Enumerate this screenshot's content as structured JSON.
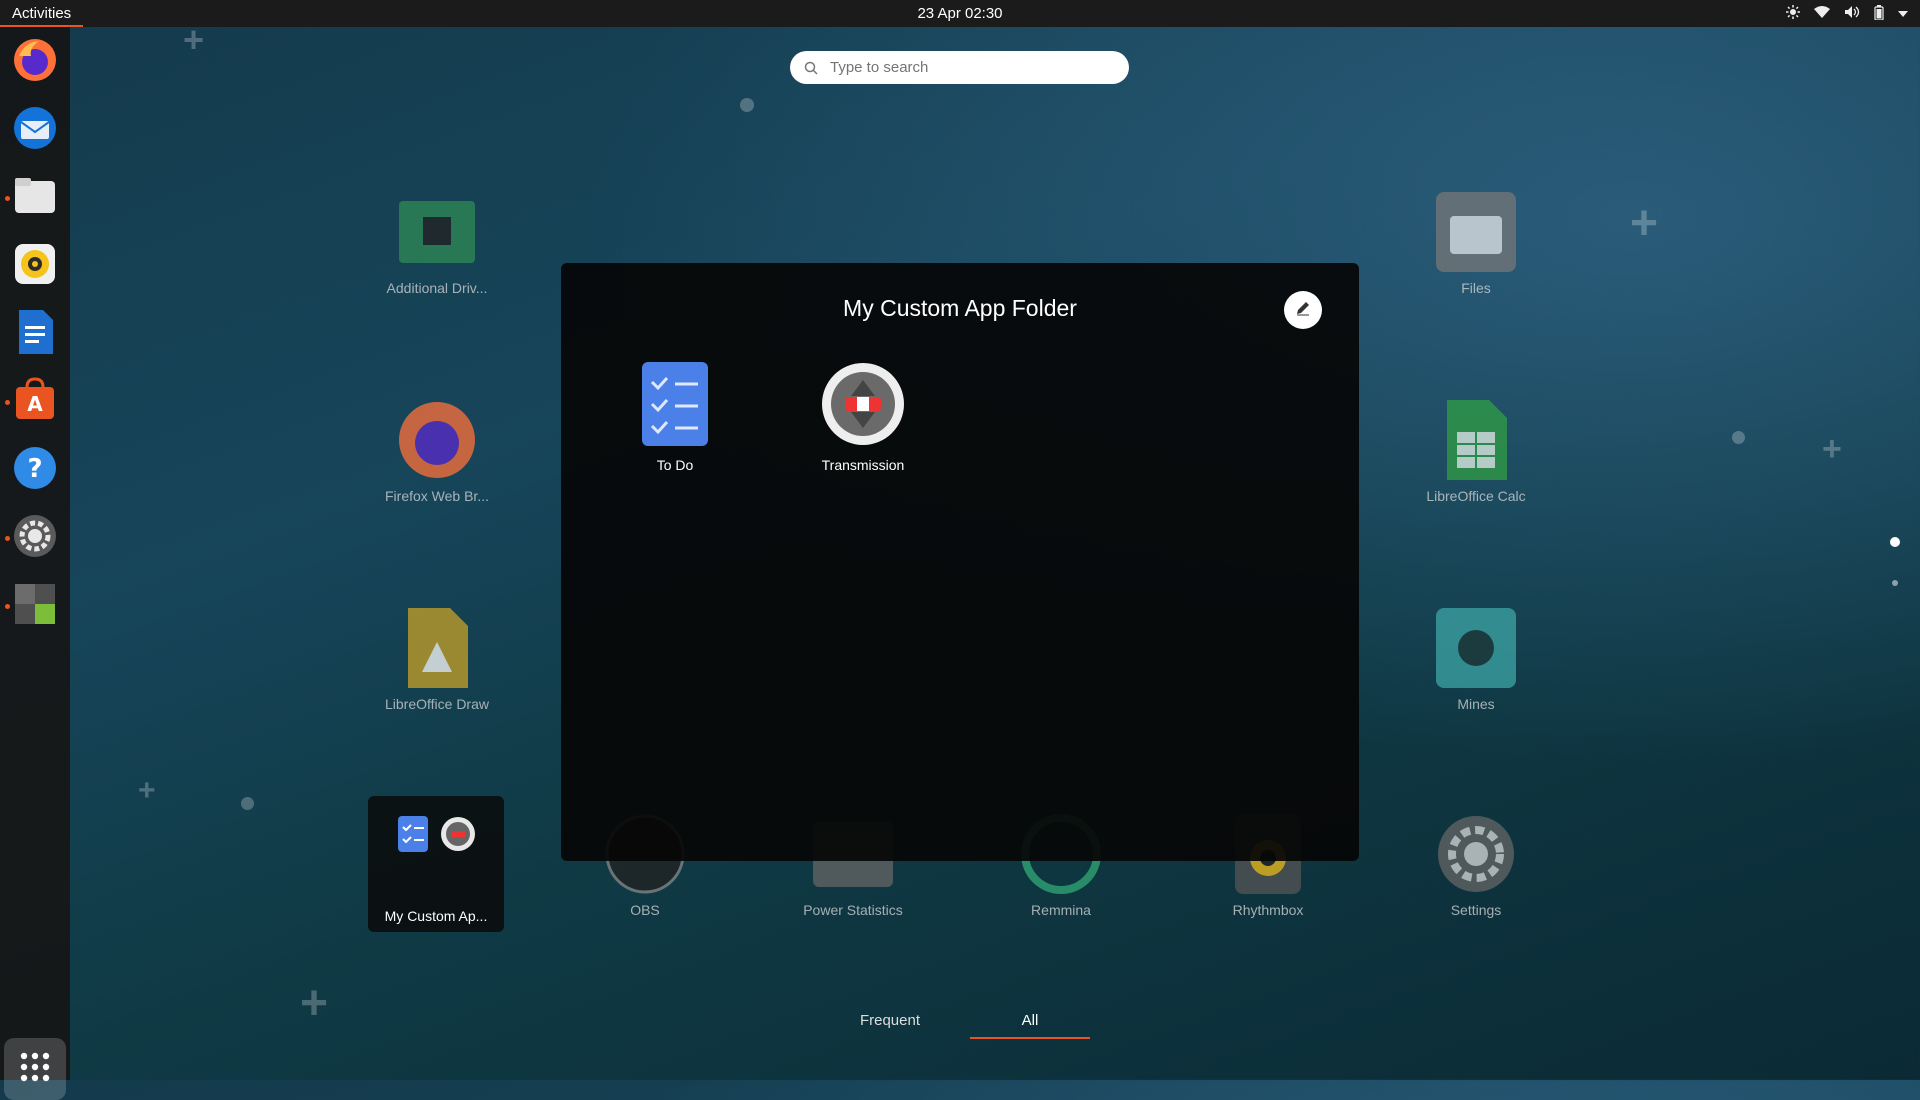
{
  "topbar": {
    "activities_label": "Activities",
    "clock": "23 Apr  02:30",
    "tray_icons": [
      "brightness-icon",
      "wifi-icon",
      "volume-icon",
      "battery-icon",
      "chevron-down-icon"
    ]
  },
  "dock": {
    "items": [
      {
        "name": "firefox",
        "icon": "firefox-icon",
        "running": false
      },
      {
        "name": "thunderbird",
        "icon": "mail-icon",
        "running": false
      },
      {
        "name": "files",
        "icon": "folder-icon",
        "running": true
      },
      {
        "name": "rhythmbox",
        "icon": "speaker-icon",
        "running": false
      },
      {
        "name": "libreoffice-writer",
        "icon": "document-icon",
        "running": false
      },
      {
        "name": "ubuntu-software",
        "icon": "store-icon",
        "running": true
      },
      {
        "name": "help",
        "icon": "help-icon",
        "running": false
      },
      {
        "name": "settings",
        "icon": "gear-icon",
        "running": true
      },
      {
        "name": "extensions",
        "icon": "puzzle-icon",
        "running": true
      }
    ],
    "show_apps_icon": "grid-icon"
  },
  "search": {
    "placeholder": "Type to search"
  },
  "grid_apps": [
    {
      "label": "Additional Driv..."
    },
    {
      "label": "Files"
    },
    {
      "label": "Firefox Web Br..."
    },
    {
      "label": "LibreOffice Calc"
    },
    {
      "label": "LibreOffice Draw"
    },
    {
      "label": "Mines"
    },
    {
      "label": "OBS"
    },
    {
      "label": "Power Statistics"
    },
    {
      "label": "Remmina"
    },
    {
      "label": "Rhythmbox"
    },
    {
      "label": "Settings"
    }
  ],
  "folder_tile": {
    "label": "My Custom Ap..."
  },
  "folder_overlay": {
    "title": "My Custom App Folder",
    "edit_icon": "pencil-icon",
    "apps": [
      {
        "label": "To Do"
      },
      {
        "label": "Transmission"
      }
    ]
  },
  "tabs": [
    {
      "label": "Frequent",
      "active": false
    },
    {
      "label": "All",
      "active": true
    }
  ],
  "colors": {
    "accent": "#e95420",
    "topbar": "#1b1b1b",
    "dock": "#161616"
  }
}
